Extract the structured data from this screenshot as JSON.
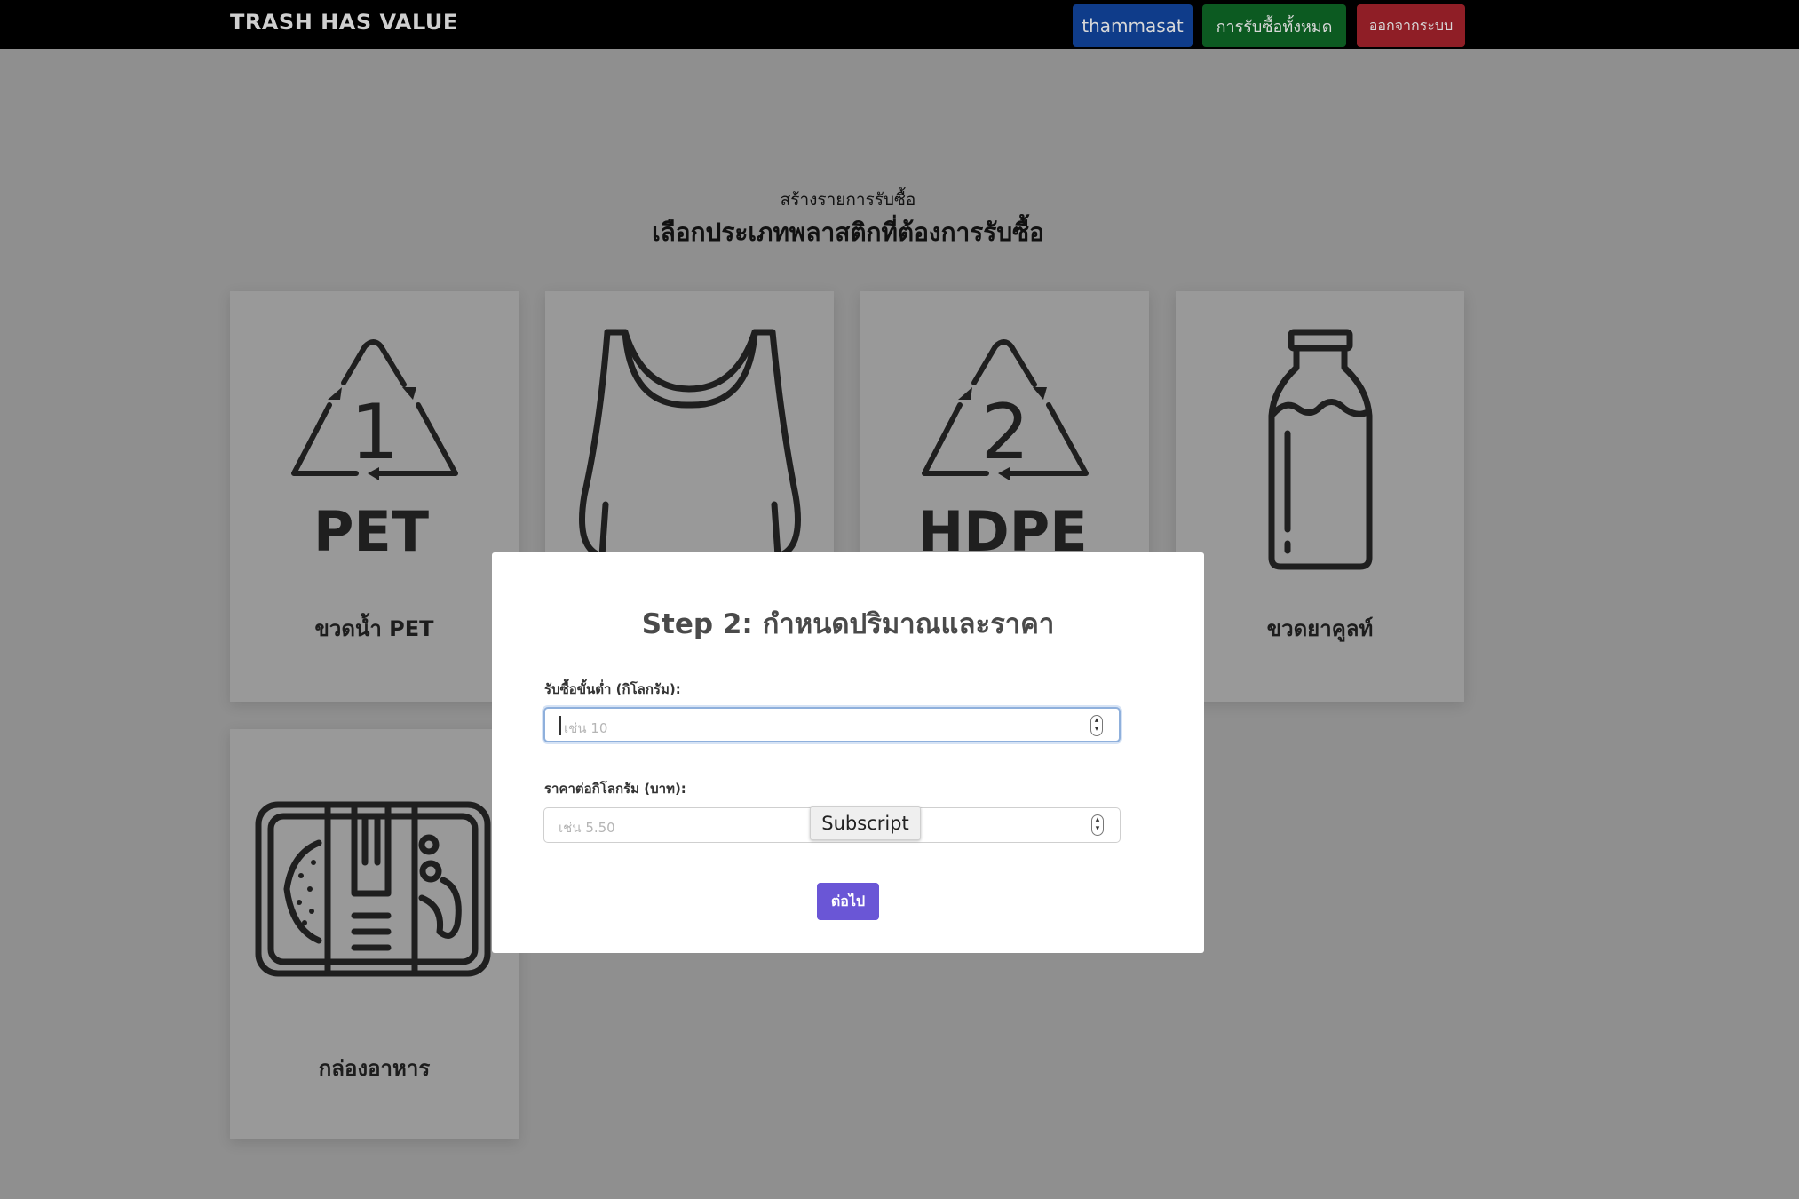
{
  "navbar": {
    "brand": "TRASH HAS VALUE",
    "user_label": "thammasat",
    "all_purchases_label": "การรับซื้อทั้งหมด",
    "logout_label": "ออกจากระบบ"
  },
  "page": {
    "subtitle": "สร้างรายการรับซื้อ",
    "title": "เลือกประเภทพลาสติกที่ต้องการรับซื้อ"
  },
  "cards": [
    {
      "label": "ขวดน้ำ PET",
      "icon": "pet-recycle-1-icon",
      "icon_text_num": "1",
      "icon_text": "PET"
    },
    {
      "label": "",
      "icon": "plastic-bag-icon"
    },
    {
      "label": "",
      "icon": "hdpe-recycle-2-icon",
      "icon_text_num": "2",
      "icon_text": "HDPE"
    },
    {
      "label": "ขวดยาคูลท์",
      "icon": "yakult-bottle-icon"
    },
    {
      "label": "กล่องอาหาร",
      "icon": "food-box-icon"
    }
  ],
  "modal": {
    "title": "Step 2: กำหนดปริมาณและราคา",
    "min_label": "รับซื้อขั้นต่ำ (กิโลกรัม):",
    "min_placeholder": "เช่น 10",
    "price_label": "ราคาต่อกิโลกรัม (บาท):",
    "price_placeholder": "เช่น 5.50",
    "tooltip": "Subscript",
    "next_label": "ต่อไป"
  },
  "colors": {
    "navbar": "#000000",
    "user_button": "#0f3c8a",
    "all_button": "#0c5a21",
    "logout_button": "#8f1e26",
    "next_button": "#6a56d6",
    "overlay_bg": "#8f8f8f"
  }
}
